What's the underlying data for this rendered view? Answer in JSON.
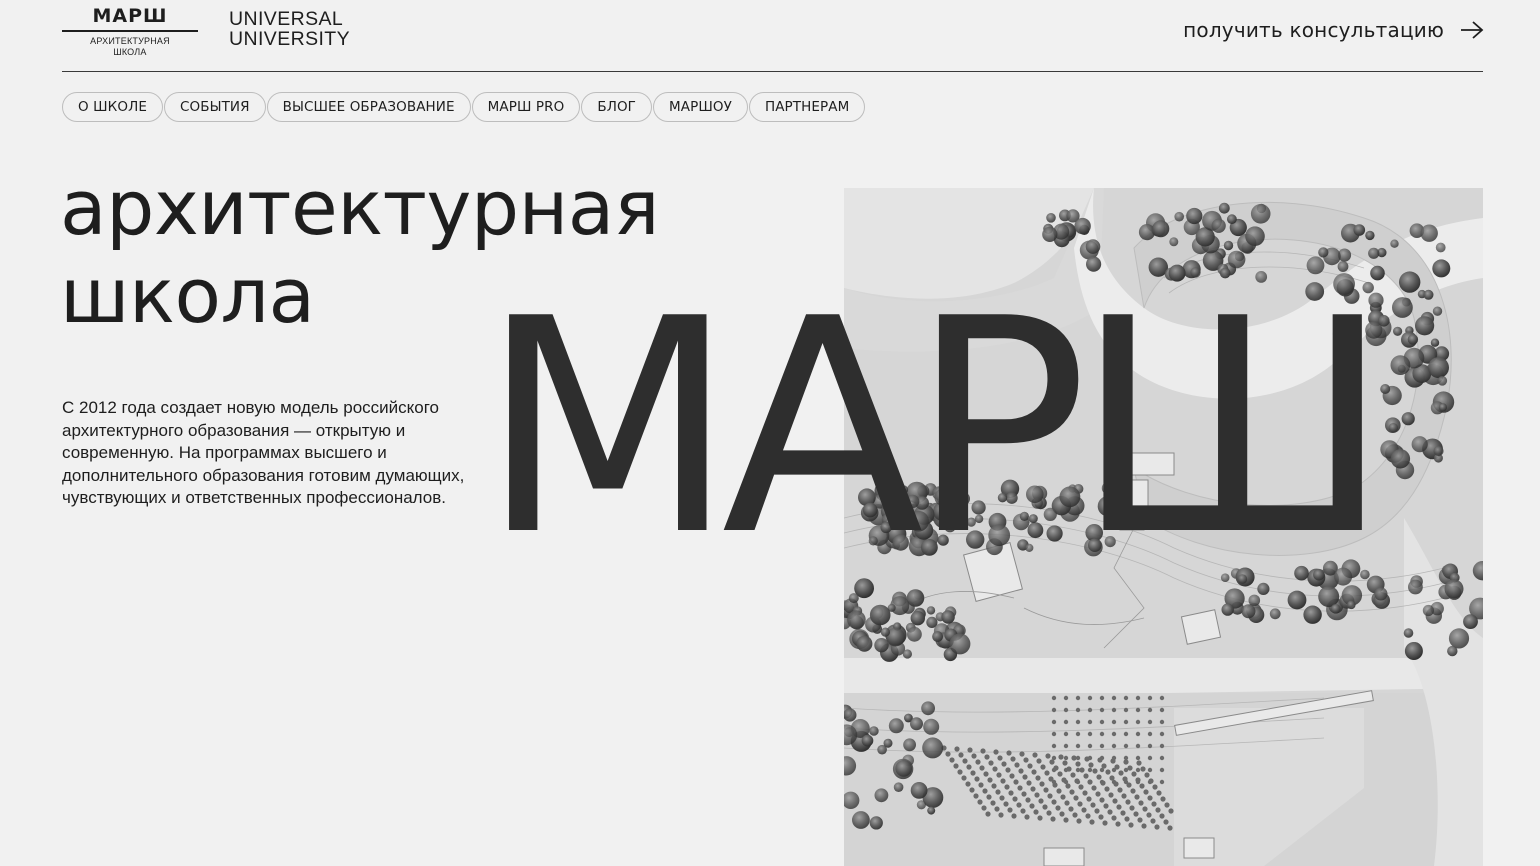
{
  "header": {
    "logo": {
      "wordmark": "МАРШ",
      "subline_1": "АРХИТЕКТУРНАЯ",
      "subline_2": "ШКОЛА"
    },
    "partner_logo": {
      "line_1": "UNIVERSAL",
      "line_2": "UNIVERSITY"
    },
    "cta": {
      "label": "получить консультацию",
      "icon": "arrow-right-icon"
    }
  },
  "nav": {
    "items": [
      {
        "label": "О ШКОЛЕ"
      },
      {
        "label": "СОБЫТИЯ"
      },
      {
        "label": "ВЫСШЕЕ ОБРАЗОВАНИЕ"
      },
      {
        "label": "МАРШ PRO"
      },
      {
        "label": "БЛОГ"
      },
      {
        "label": "МАРШОУ"
      },
      {
        "label": "ПАРТНЕРАМ"
      }
    ]
  },
  "hero": {
    "title_line_1": "архитектурная",
    "title_line_2": "школа",
    "big_word": "МАРШ",
    "description": "С 2012 года создает новую модель российского архитектурного образования — открытую и современную. На программах высшего и дополнительного образования готовим думающих, чувствующих и ответственных профессионалов."
  },
  "colors": {
    "background": "#f1f1f1",
    "text": "#1e1e1e",
    "big_word": "#2e2e2e",
    "pill_border": "#bdbdbd"
  }
}
